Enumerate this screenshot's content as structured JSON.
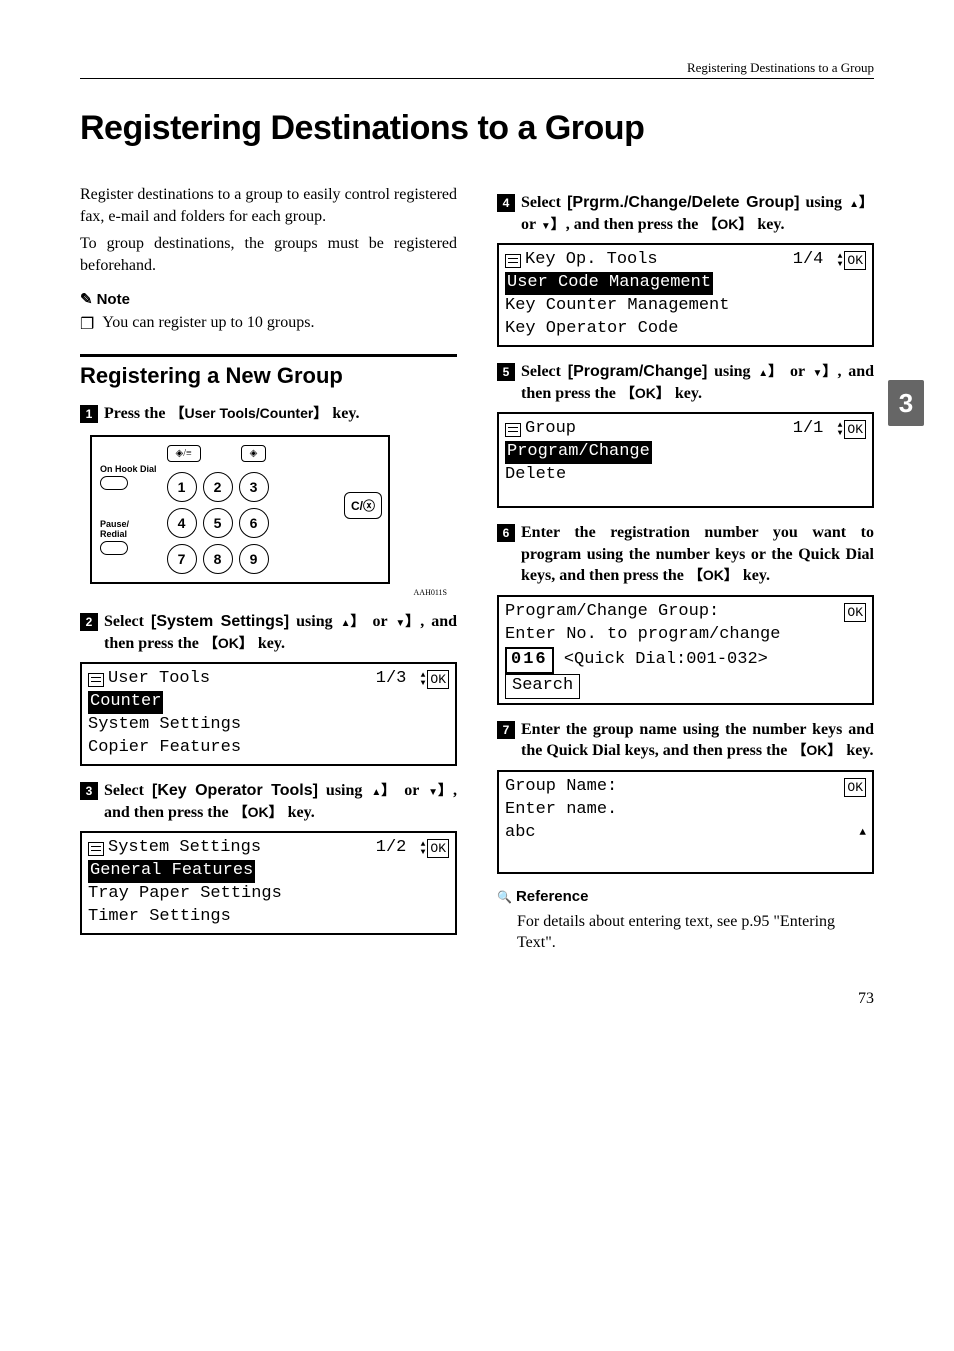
{
  "running_head": "Registering Destinations to a Group",
  "title": "Registering Destinations to a Group",
  "intro1": "Register destinations to a group to easily control registered fax, e-mail and folders for each group.",
  "intro2": "To group destinations, the groups must be registered beforehand.",
  "note_label": "Note",
  "note_item": "You can register up to 10 groups.",
  "section_heading": "Registering a New Group",
  "steps": {
    "s1": {
      "pre": "Press the ",
      "key": "User Tools/Counter",
      "post": " key."
    },
    "s2": {
      "pre": "Select ",
      "label": "[System Settings]",
      "mid": " using ",
      "mid2": " or ",
      "post": ", and then press the ",
      "ok": "OK",
      "tail": " key."
    },
    "s3": {
      "pre": "Select ",
      "label": "[Key Operator Tools]",
      "mid": " using ",
      "mid2": " or ",
      "post": ", and then press the ",
      "ok": "OK",
      "tail": " key."
    },
    "s4": {
      "pre": "Select ",
      "label": "[Prgrm./Change/Delete Group]",
      "mid": " using ",
      "mid2": " or ",
      "post": ", and then press the ",
      "ok": "OK",
      "tail": " key."
    },
    "s5": {
      "pre": "Select ",
      "label": "[Program/Change]",
      "mid": " using ",
      "mid2": " or ",
      "post": ", and then press the ",
      "ok": "OK",
      "tail": " key."
    },
    "s6": "Enter the registration number you want to program using the number keys or the Quick Dial keys, and then press the ",
    "s6_tail": " key.",
    "s7": "Enter the group name using the number keys and the Quick Dial keys, and then press the ",
    "s7_tail": " key."
  },
  "keypad": {
    "left1": "On Hook Dial",
    "left2": "Pause/\nRedial",
    "top1": "◈/≡",
    "top2": "◈",
    "numbers": [
      "1",
      "2",
      "3",
      "4",
      "5",
      "6",
      "7",
      "8",
      "9"
    ],
    "side": "C/ⓧ",
    "figid": "AAH011S"
  },
  "lcd2": {
    "title": "User Tools",
    "page": "1/3",
    "sel": "Counter",
    "l2": "System Settings",
    "l3": "Copier Features"
  },
  "lcd3": {
    "title": "System Settings",
    "page": "1/2",
    "sel": "General Features",
    "l2": "Tray Paper Settings",
    "l3": "Timer Settings"
  },
  "lcd4": {
    "title": "Key Op. Tools",
    "page": "1/4",
    "sel": "User Code Management",
    "l2": "Key Counter Management",
    "l3": "Key Operator Code"
  },
  "lcd5": {
    "title": "Group",
    "page": "1/1",
    "sel": "Program/Change",
    "l2": "Delete",
    "l3": ""
  },
  "lcd6": {
    "l1": "Program/Change Group:",
    "l2": "Enter No. to program/change",
    "code": "016",
    "hint": "<Quick Dial:001-032>",
    "btn": "Search"
  },
  "lcd7": {
    "l1": "Group Name:",
    "l2": "Enter name.",
    "l3": "abc"
  },
  "ref_label": "Reference",
  "ref_text": "For details about entering text, see p.95 \"Entering Text\".",
  "sidetab": "3",
  "pagenum": "73"
}
